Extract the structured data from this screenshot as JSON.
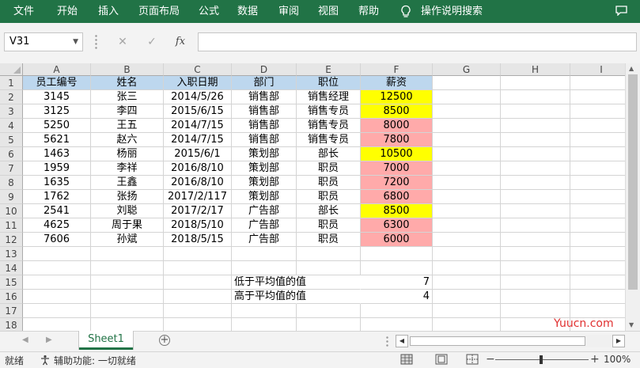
{
  "ribbon": {
    "tabs": [
      "文件",
      "开始",
      "插入",
      "页面布局",
      "公式",
      "数据",
      "审阅",
      "视图",
      "帮助"
    ],
    "search_label": "操作说明搜索",
    "accent": "#217346"
  },
  "formula_bar": {
    "name_box": "V31",
    "cancel_icon": "✕",
    "enter_icon": "✓",
    "function_icon": "fx",
    "formula": ""
  },
  "columns": [
    "A",
    "B",
    "C",
    "D",
    "E",
    "F",
    "G",
    "H",
    "I"
  ],
  "rows": [
    "1",
    "2",
    "3",
    "4",
    "5",
    "6",
    "7",
    "8",
    "9",
    "10",
    "11",
    "12",
    "13",
    "14",
    "15",
    "16",
    "17",
    "18"
  ],
  "table": {
    "headers": [
      "员工编号",
      "姓名",
      "入职日期",
      "部门",
      "职位",
      "薪资"
    ],
    "data": [
      [
        "3145",
        "张三",
        "2014/5/26",
        "销售部",
        "销售经理",
        "12500"
      ],
      [
        "3125",
        "李四",
        "2015/6/15",
        "销售部",
        "销售专员",
        "8500"
      ],
      [
        "5250",
        "王五",
        "2014/7/15",
        "销售部",
        "销售专员",
        "8000"
      ],
      [
        "5621",
        "赵六",
        "2014/7/15",
        "销售部",
        "销售专员",
        "7800"
      ],
      [
        "1463",
        "杨丽",
        "2015/6/1",
        "策划部",
        "部长",
        "10500"
      ],
      [
        "1959",
        "李祥",
        "2016/8/10",
        "策划部",
        "职员",
        "7000"
      ],
      [
        "1635",
        "王鑫",
        "2016/8/10",
        "策划部",
        "职员",
        "7200"
      ],
      [
        "1762",
        "张扬",
        "2017/2/117",
        "策划部",
        "职员",
        "6800"
      ],
      [
        "2541",
        "刘聪",
        "2017/2/17",
        "广告部",
        "部长",
        "8500"
      ],
      [
        "4625",
        "周于果",
        "2018/5/10",
        "广告部",
        "职员",
        "6300"
      ],
      [
        "7606",
        "孙斌",
        "2018/5/15",
        "广告部",
        "职员",
        "6000"
      ]
    ],
    "salary_highlight": [
      "yellow",
      "yellow",
      "pink",
      "pink",
      "yellow",
      "pink",
      "pink",
      "pink",
      "yellow",
      "pink",
      "pink"
    ],
    "colors": {
      "header": "#bdd7ee",
      "above_avg": "#ffff00",
      "below_avg": "#ffaaaa"
    }
  },
  "summary": {
    "below_label": "低于平均值的值",
    "below_value": "7",
    "above_label": "高于平均值的值",
    "above_value": "4"
  },
  "sheets": {
    "active": "Sheet1"
  },
  "status": {
    "ready": "就绪",
    "accessibility": "辅助功能: 一切就绪",
    "zoom": "100%"
  },
  "watermark": "Yuucn.com"
}
